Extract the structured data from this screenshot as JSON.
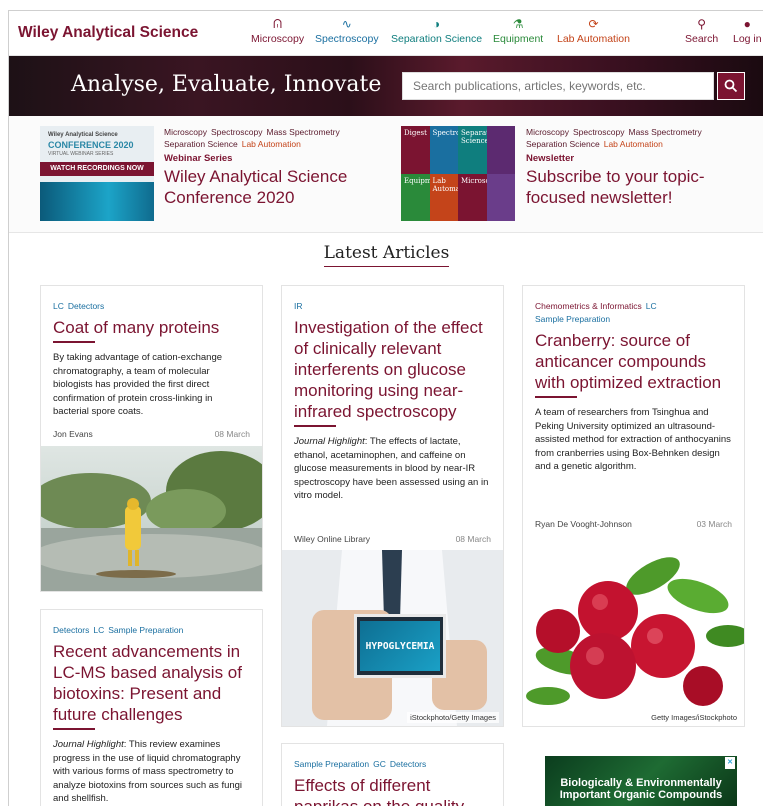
{
  "brand": "Wiley Analytical Science",
  "nav": [
    {
      "label": "Microscopy",
      "icon": "ᕬ"
    },
    {
      "label": "Spectroscopy",
      "icon": "∿"
    },
    {
      "label": "Separation Science",
      "icon": "◑"
    },
    {
      "label": "Equipment",
      "icon": "⚗"
    },
    {
      "label": "Lab Automation",
      "icon": "⟳"
    }
  ],
  "search_nav": {
    "label": "Search",
    "icon": "⚲"
  },
  "login_nav": {
    "label": "Log in",
    "icon": "●"
  },
  "hero": {
    "title": "Analyse, Evaluate, Innovate",
    "search_placeholder": "Search publications, articles, keywords, etc."
  },
  "promos": [
    {
      "tags_line1": [
        "Microscopy",
        "Spectroscopy",
        "Mass Spectrometry"
      ],
      "tags_line2": [
        "Separation Science",
        "Lab Automation"
      ],
      "kicker": "Webinar Series",
      "title": "Wiley Analytical Science Conference 2020",
      "image": {
        "line1": "Wiley Analytical Science",
        "line2": "CONFERENCE 2020",
        "line3": "VIRTUAL WEBINAR SERIES",
        "button": "WATCH RECORDINGS NOW"
      }
    },
    {
      "tags_line1": [
        "Microscopy",
        "Spectroscopy",
        "Mass Spectrometry"
      ],
      "tags_line2": [
        "Separation Science",
        "Lab Automation"
      ],
      "kicker": "Newsletter",
      "title": "Subscribe to your topic-focused newsletter!",
      "image": {
        "tiles": [
          "Digest",
          "Spectroscopy",
          "Separation Science",
          "",
          "Equipment",
          "Lab Automation",
          "Microscopy",
          ""
        ]
      }
    }
  ],
  "section_title": "Latest Articles",
  "articles": [
    {
      "tags": [
        "LC",
        "Detectors"
      ],
      "title": "Coat of many proteins",
      "excerpt_prefix": "",
      "excerpt": "By taking advantage of cation-exchange chromatography, a team of molecular biologists has provided the first direct confirmation of protein cross-linking in bacterial spore coats.",
      "author": "Jon Evans",
      "date": "08 March",
      "credit": ""
    },
    {
      "tags": [
        "IR"
      ],
      "title": "Investigation of the effect of clinically relevant interferents on glucose monitoring using near-infrared spectroscopy",
      "excerpt_prefix": "Journal Highlight",
      "excerpt": ": The effects of lactate, ethanol, acetaminophen, and caffeine on glucose measurements in blood by near-IR spectroscopy have been assessed using an in vitro model.",
      "author": "Wiley Online Library",
      "date": "08 March",
      "credit": "iStockphoto/Getty Images",
      "image_text": "HYPOGLYCEMIA"
    },
    {
      "tags": [
        "Chemometrics & Informatics",
        "LC",
        "Sample Preparation"
      ],
      "title": "Cranberry: source of anticancer compounds with optimized extraction",
      "excerpt_prefix": "",
      "excerpt": "A team of researchers from Tsinghua and Peking University optimized an ultrasound-assisted method for extraction of anthocyanins from cranberries using Box-Behnken design and a genetic algorithm.",
      "author": "Ryan De Vooght-Johnson",
      "date": "03 March",
      "credit": "Getty Images/iStockphoto"
    },
    {
      "tags": [
        "Detectors",
        "LC",
        "Sample Preparation"
      ],
      "title": "Recent advancements in LC-MS based analysis of biotoxins: Present and future challenges",
      "excerpt_prefix": "Journal Highlight",
      "excerpt": ": This review examines progress in the use of liquid chromatography with various forms of mass spectrometry to analyze biotoxins from sources such as fungi and shellfish."
    },
    {
      "tags": [
        "Sample Preparation",
        "GC",
        "Detectors"
      ],
      "title": "Effects of different paprikas on the quality"
    }
  ],
  "ad": {
    "text": "Biologically & Environmentally Important Organic Compounds"
  },
  "colors": {
    "brand": "#7b1431",
    "tag": "#1a6fa0"
  }
}
